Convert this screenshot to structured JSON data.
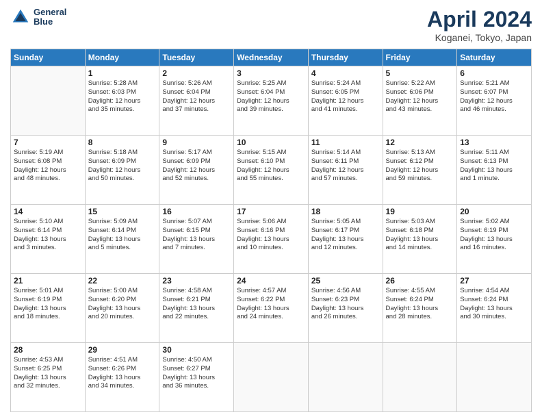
{
  "header": {
    "logo_line1": "General",
    "logo_line2": "Blue",
    "title": "April 2024",
    "location": "Koganei, Tokyo, Japan"
  },
  "weekdays": [
    "Sunday",
    "Monday",
    "Tuesday",
    "Wednesday",
    "Thursday",
    "Friday",
    "Saturday"
  ],
  "weeks": [
    [
      {
        "day": "",
        "info": ""
      },
      {
        "day": "1",
        "info": "Sunrise: 5:28 AM\nSunset: 6:03 PM\nDaylight: 12 hours\nand 35 minutes."
      },
      {
        "day": "2",
        "info": "Sunrise: 5:26 AM\nSunset: 6:04 PM\nDaylight: 12 hours\nand 37 minutes."
      },
      {
        "day": "3",
        "info": "Sunrise: 5:25 AM\nSunset: 6:04 PM\nDaylight: 12 hours\nand 39 minutes."
      },
      {
        "day": "4",
        "info": "Sunrise: 5:24 AM\nSunset: 6:05 PM\nDaylight: 12 hours\nand 41 minutes."
      },
      {
        "day": "5",
        "info": "Sunrise: 5:22 AM\nSunset: 6:06 PM\nDaylight: 12 hours\nand 43 minutes."
      },
      {
        "day": "6",
        "info": "Sunrise: 5:21 AM\nSunset: 6:07 PM\nDaylight: 12 hours\nand 46 minutes."
      }
    ],
    [
      {
        "day": "7",
        "info": "Sunrise: 5:19 AM\nSunset: 6:08 PM\nDaylight: 12 hours\nand 48 minutes."
      },
      {
        "day": "8",
        "info": "Sunrise: 5:18 AM\nSunset: 6:09 PM\nDaylight: 12 hours\nand 50 minutes."
      },
      {
        "day": "9",
        "info": "Sunrise: 5:17 AM\nSunset: 6:09 PM\nDaylight: 12 hours\nand 52 minutes."
      },
      {
        "day": "10",
        "info": "Sunrise: 5:15 AM\nSunset: 6:10 PM\nDaylight: 12 hours\nand 55 minutes."
      },
      {
        "day": "11",
        "info": "Sunrise: 5:14 AM\nSunset: 6:11 PM\nDaylight: 12 hours\nand 57 minutes."
      },
      {
        "day": "12",
        "info": "Sunrise: 5:13 AM\nSunset: 6:12 PM\nDaylight: 12 hours\nand 59 minutes."
      },
      {
        "day": "13",
        "info": "Sunrise: 5:11 AM\nSunset: 6:13 PM\nDaylight: 13 hours\nand 1 minute."
      }
    ],
    [
      {
        "day": "14",
        "info": "Sunrise: 5:10 AM\nSunset: 6:14 PM\nDaylight: 13 hours\nand 3 minutes."
      },
      {
        "day": "15",
        "info": "Sunrise: 5:09 AM\nSunset: 6:14 PM\nDaylight: 13 hours\nand 5 minutes."
      },
      {
        "day": "16",
        "info": "Sunrise: 5:07 AM\nSunset: 6:15 PM\nDaylight: 13 hours\nand 7 minutes."
      },
      {
        "day": "17",
        "info": "Sunrise: 5:06 AM\nSunset: 6:16 PM\nDaylight: 13 hours\nand 10 minutes."
      },
      {
        "day": "18",
        "info": "Sunrise: 5:05 AM\nSunset: 6:17 PM\nDaylight: 13 hours\nand 12 minutes."
      },
      {
        "day": "19",
        "info": "Sunrise: 5:03 AM\nSunset: 6:18 PM\nDaylight: 13 hours\nand 14 minutes."
      },
      {
        "day": "20",
        "info": "Sunrise: 5:02 AM\nSunset: 6:19 PM\nDaylight: 13 hours\nand 16 minutes."
      }
    ],
    [
      {
        "day": "21",
        "info": "Sunrise: 5:01 AM\nSunset: 6:19 PM\nDaylight: 13 hours\nand 18 minutes."
      },
      {
        "day": "22",
        "info": "Sunrise: 5:00 AM\nSunset: 6:20 PM\nDaylight: 13 hours\nand 20 minutes."
      },
      {
        "day": "23",
        "info": "Sunrise: 4:58 AM\nSunset: 6:21 PM\nDaylight: 13 hours\nand 22 minutes."
      },
      {
        "day": "24",
        "info": "Sunrise: 4:57 AM\nSunset: 6:22 PM\nDaylight: 13 hours\nand 24 minutes."
      },
      {
        "day": "25",
        "info": "Sunrise: 4:56 AM\nSunset: 6:23 PM\nDaylight: 13 hours\nand 26 minutes."
      },
      {
        "day": "26",
        "info": "Sunrise: 4:55 AM\nSunset: 6:24 PM\nDaylight: 13 hours\nand 28 minutes."
      },
      {
        "day": "27",
        "info": "Sunrise: 4:54 AM\nSunset: 6:24 PM\nDaylight: 13 hours\nand 30 minutes."
      }
    ],
    [
      {
        "day": "28",
        "info": "Sunrise: 4:53 AM\nSunset: 6:25 PM\nDaylight: 13 hours\nand 32 minutes."
      },
      {
        "day": "29",
        "info": "Sunrise: 4:51 AM\nSunset: 6:26 PM\nDaylight: 13 hours\nand 34 minutes."
      },
      {
        "day": "30",
        "info": "Sunrise: 4:50 AM\nSunset: 6:27 PM\nDaylight: 13 hours\nand 36 minutes."
      },
      {
        "day": "",
        "info": ""
      },
      {
        "day": "",
        "info": ""
      },
      {
        "day": "",
        "info": ""
      },
      {
        "day": "",
        "info": ""
      }
    ]
  ]
}
